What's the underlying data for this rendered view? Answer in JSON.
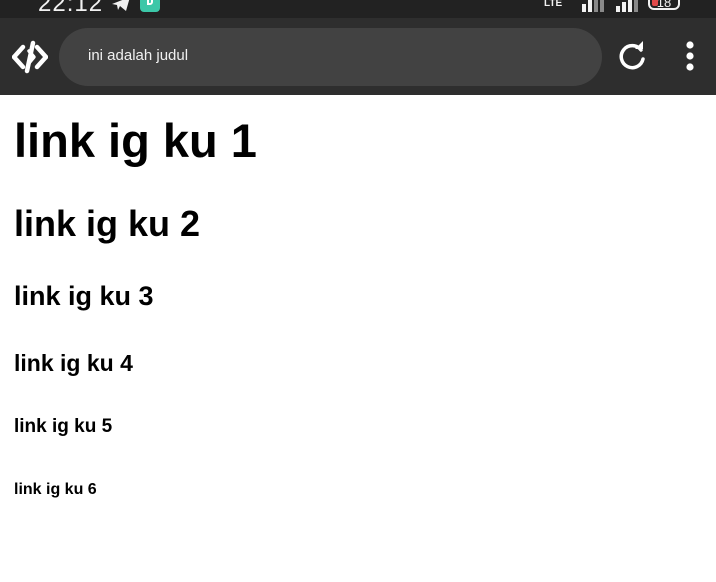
{
  "status_bar": {
    "time": "22:12",
    "network_label": "LTE",
    "battery_level": "18",
    "icons": [
      "telegram-icon",
      "app-badge-icon",
      "signal-icon",
      "battery-icon"
    ]
  },
  "browser": {
    "address_text": "ini adalah judul",
    "icons": [
      "browser-logo-icon",
      "reload-icon",
      "more-vert-icon"
    ]
  },
  "page": {
    "headings": [
      "link ig ku 1",
      "link ig ku 2",
      "link ig ku 3",
      "link ig ku 4",
      "link ig ku 5",
      "link ig ku 6"
    ]
  },
  "colors": {
    "toolbar_bg": "#2e2e2e",
    "address_bg": "#424242",
    "status_bg": "#222222",
    "page_bg": "#ffffff",
    "text": "#000000"
  }
}
